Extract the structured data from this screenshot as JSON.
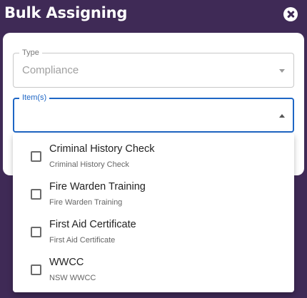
{
  "dialog": {
    "title": "Bulk Assigning",
    "close_icon": "close-circle-icon"
  },
  "type_field": {
    "label": "Type",
    "value": "Compliance",
    "icon": "dropdown-arrow-down-icon"
  },
  "items_field": {
    "label": "Item(s)",
    "value": "",
    "icon": "dropdown-arrow-up-icon"
  },
  "options": [
    {
      "title": "Criminal History Check",
      "subtitle": "Criminal History Check",
      "checked": false
    },
    {
      "title": "Fire Warden Training",
      "subtitle": "Fire Warden Training",
      "checked": false
    },
    {
      "title": "First Aid Certificate",
      "subtitle": "First Aid Certificate",
      "checked": false
    },
    {
      "title": "WWCC",
      "subtitle": "NSW WWCC",
      "checked": false
    }
  ],
  "colors": {
    "background": "#3f2a56",
    "accent": "#1e66c5"
  }
}
